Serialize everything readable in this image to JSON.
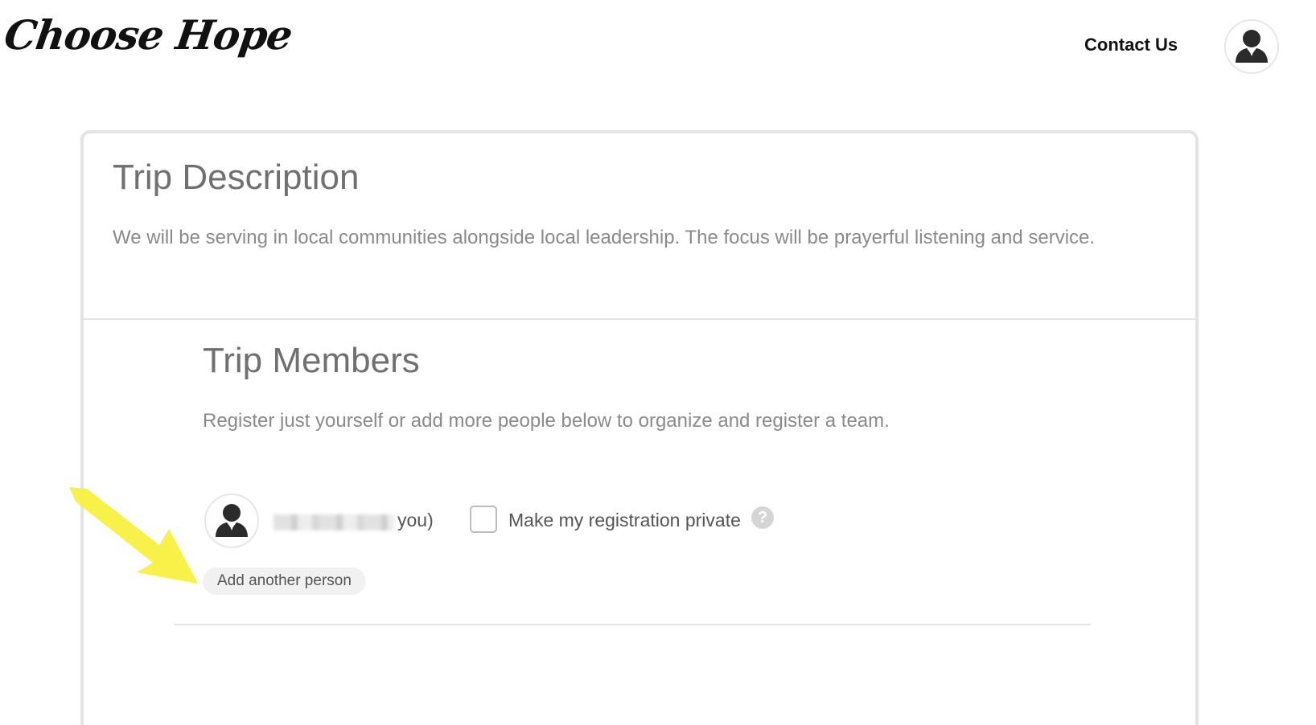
{
  "header": {
    "logo_text": "Choose Hope",
    "contact_link": "Contact Us",
    "avatar_icon": "user-silhouette-icon"
  },
  "trip_description": {
    "title": "Trip Description",
    "text": "We will be serving in local communities alongside local leadership. The focus will be prayerful listening and service."
  },
  "trip_members": {
    "title": "Trip Members",
    "subtitle": "Register just yourself or add more people below to organize and register a team.",
    "member": {
      "avatar_icon": "user-silhouette-icon",
      "name_suffix": "you)",
      "private_label": "Make my registration private",
      "private_checked": false,
      "help_glyph": "?"
    },
    "add_person_label": "Add another person"
  },
  "colors": {
    "annotation_arrow": "#f7f03a",
    "card_border": "#e4e4e4",
    "heading": "#707070"
  }
}
